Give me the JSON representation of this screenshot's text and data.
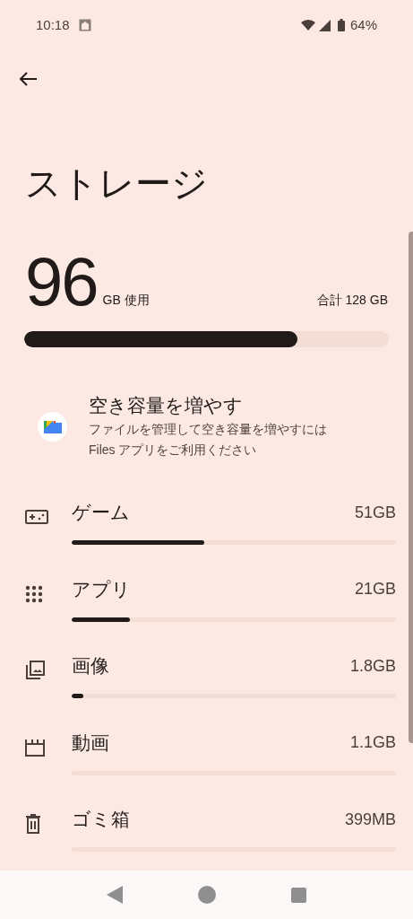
{
  "status_bar": {
    "time": "10:18",
    "battery": "64%"
  },
  "title": "ストレージ",
  "usage": {
    "used": "96",
    "used_unit": "GB 使用",
    "total": "合計 128 GB",
    "level": 0.75
  },
  "files_card": {
    "title": "空き容量を増やす",
    "description": "ファイルを管理して空き容量を増やすには Files アプリをご利用ください"
  },
  "categories": [
    {
      "kind": "games",
      "label": "ゲーム",
      "size": "51GB",
      "level": 0.41
    },
    {
      "kind": "apps",
      "label": "アプリ",
      "size": "21GB",
      "level": 0.18
    },
    {
      "kind": "images",
      "label": "画像",
      "size": "1.8GB",
      "level": 0.035
    },
    {
      "kind": "videos",
      "label": "動画",
      "size": "1.1GB",
      "level": 0.0
    },
    {
      "kind": "trash",
      "label": "ゴミ箱",
      "size": "399MB",
      "level": 0.0
    }
  ]
}
